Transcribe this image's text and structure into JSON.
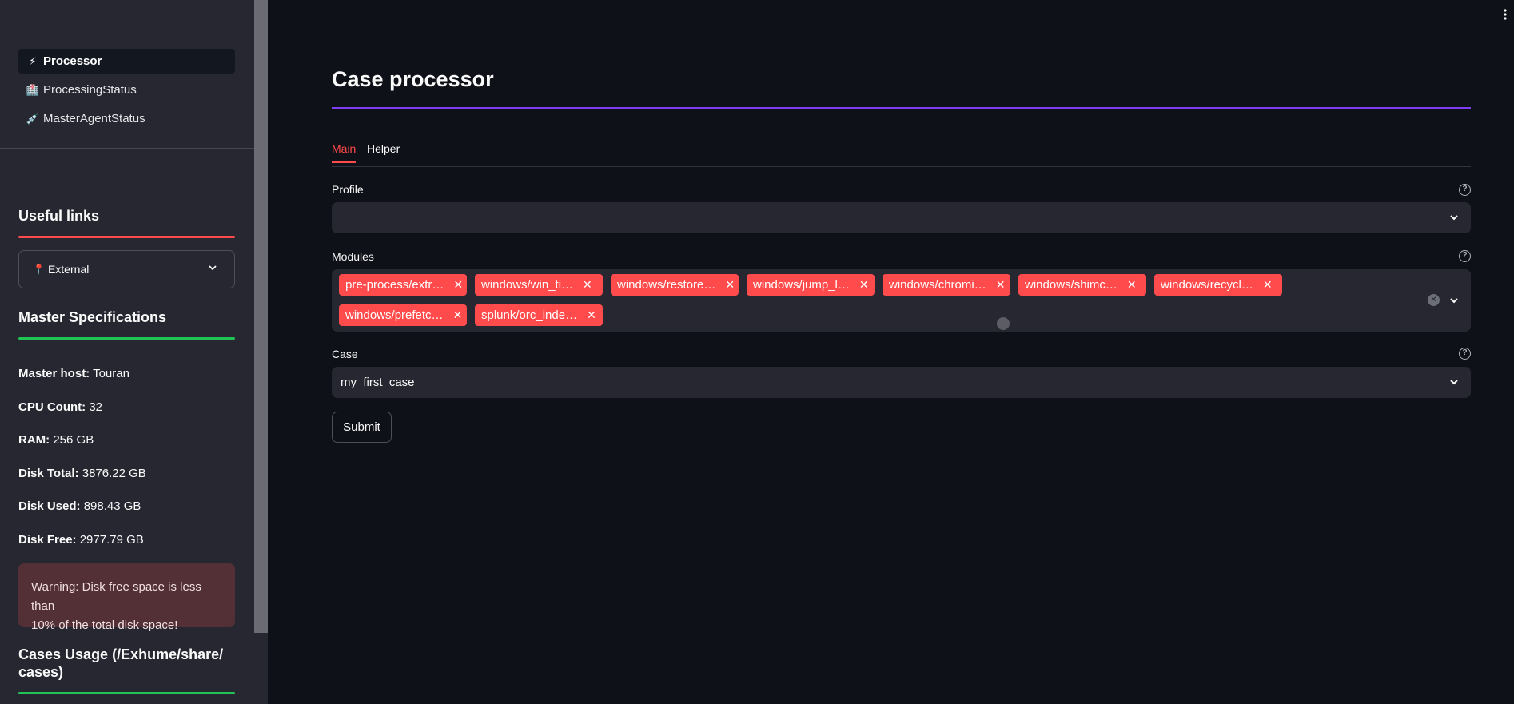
{
  "sidebar": {
    "nav": [
      {
        "label": "Processor",
        "icon": "lightning-icon",
        "glyph": "⚡",
        "active": true
      },
      {
        "label": "ProcessingStatus",
        "icon": "hospital-icon",
        "glyph": "🏥",
        "active": false
      },
      {
        "label": "MasterAgentStatus",
        "icon": "syringe-icon",
        "glyph": "💉",
        "active": false
      }
    ],
    "useful_links": {
      "title": "Useful links",
      "select_value": "External"
    },
    "master_specs": {
      "title": "Master Specifications",
      "items": [
        {
          "label": "Master host:",
          "value": "Touran"
        },
        {
          "label": "CPU Count:",
          "value": "32"
        },
        {
          "label": "RAM:",
          "value": "256 GB"
        },
        {
          "label": "Disk Total:",
          "value": "3876.22 GB"
        },
        {
          "label": "Disk Used:",
          "value": "898.43 GB"
        },
        {
          "label": "Disk Free:",
          "value": "2977.79 GB"
        }
      ],
      "warning_line1": "Warning: Disk free space is less than",
      "warning_line2": "10% of the total disk space!"
    },
    "cases_usage": {
      "title_line1": "Cases Usage (/Exhume/share/",
      "title_line2": "cases)"
    }
  },
  "colors": {
    "accent_red": "#ff4b4b",
    "title_rule": "#7d3ef5",
    "rule_green": "#21c354",
    "warning_bg": "#533035"
  },
  "main": {
    "title": "Case processor",
    "tabs": [
      {
        "label": "Main",
        "active": true
      },
      {
        "label": "Helper",
        "active": false
      }
    ],
    "profile": {
      "label": "Profile",
      "value": ""
    },
    "modules": {
      "label": "Modules",
      "tags": [
        "pre-process/extr…",
        "windows/win_ti…",
        "windows/restore…",
        "windows/jump_l…",
        "windows/chromi…",
        "windows/shimc…",
        "windows/recycl…",
        "windows/prefetc…",
        "splunk/orc_inde…"
      ]
    },
    "case": {
      "label": "Case",
      "value": "my_first_case"
    },
    "submit_label": "Submit"
  }
}
